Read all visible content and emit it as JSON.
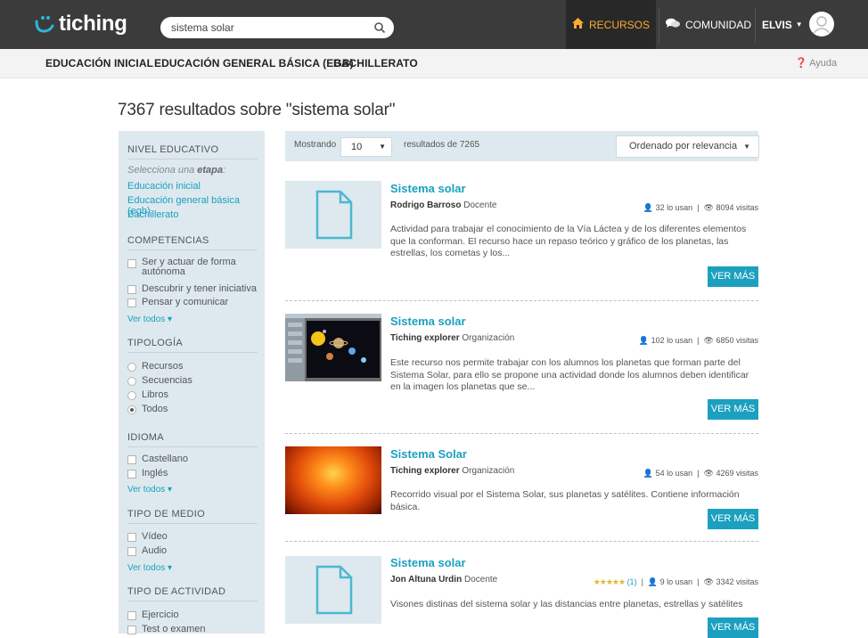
{
  "app": {
    "logo_text": "tiching"
  },
  "search": {
    "value": "sistema solar",
    "placeholder": "Buscar"
  },
  "topnav": {
    "recursos": "RECURSOS",
    "comunidad": "COMUNIDAD",
    "user": "ELVIS"
  },
  "levels": [
    "EDUCACIÓN INICIAL",
    "EDUCACIÓN GENERAL BÁSICA (EGB)",
    "BACHILLERATO"
  ],
  "help": "Ayuda",
  "results_title": "7367 resultados sobre \"sistema solar\"",
  "sidebar": {
    "nivel": {
      "heading": "NIVEL EDUCATIVO",
      "hint": "Selecciona una etapa:",
      "links": [
        "Educación inicial",
        "Educación general básica (egb)",
        "Bachillerato"
      ]
    },
    "competencias": {
      "heading": "COMPETENCIAS",
      "options": [
        "Ser y actuar de forma autónoma",
        "Descubrir y tener iniciativa",
        "Pensar y comunicar"
      ],
      "more": "Ver todos"
    },
    "tipologia": {
      "heading": "TIPOLOGÍA",
      "options": [
        "Recursos",
        "Secuencias",
        "Libros",
        "Todos"
      ],
      "selected": "Todos"
    },
    "idioma": {
      "heading": "IDIOMA",
      "options": [
        "Castellano",
        "Inglés"
      ],
      "more": "Ver todos"
    },
    "medio": {
      "heading": "TIPO DE MEDIO",
      "options": [
        "Vídeo",
        "Audio"
      ],
      "more": "Ver todos"
    },
    "actividad": {
      "heading": "TIPO DE ACTIVIDAD",
      "options": [
        "Ejercicio",
        "Test o examen"
      ]
    }
  },
  "controls": {
    "showing_label": "Mostrando",
    "per_page": "10",
    "of_label": "resultados de 7265",
    "order": "Ordenado por relevancia"
  },
  "results": [
    {
      "title": "Sistema solar",
      "author": "Rodrigo Barroso",
      "role": "Docente",
      "uses": "32 lo usan",
      "visits": "8094 visitas",
      "rating": "",
      "desc": "Actividad para trabajar el conocimiento de la Vía Láctea y de los diferentes elementos que la conforman. El recurso hace un repaso teórico y gráfico de los planetas, las estrellas, los cometas y los...",
      "button": "VER MÁS"
    },
    {
      "title": "Sistema solar",
      "author": "Tiching explorer",
      "role": "Organización",
      "uses": "102 lo usan",
      "visits": "6850 visitas",
      "rating": "",
      "desc": "Este recurso nos permite trabajar con los alumnos los planetas que forman parte del Sistema Solar, para ello se propone una actividad donde los alumnos deben identificar en la imagen los planetas que se...",
      "button": "VER MÁS"
    },
    {
      "title": "Sistema Solar",
      "author": "Tiching explorer",
      "role": "Organización",
      "uses": "54 lo usan",
      "visits": "4269 visitas",
      "rating": "",
      "desc": "Recorrido visual por el Sistema Solar, sus planetas y satélites. Contiene información básica.",
      "button": "VER MÁS"
    },
    {
      "title": "Sistema solar",
      "author": "Jon Altuna Urdin",
      "role": "Docente",
      "uses": "9 lo usan",
      "visits": "3342 visitas",
      "rating": "(1)",
      "stars": 5,
      "desc": "Visones distinas del sistema solar y las distancias entre planetas, estrellas y satélites",
      "button": "VER MÁS"
    }
  ],
  "colors": {
    "accent": "#1ca0bf",
    "topbar": "#3b3b3b",
    "nav_active": "#ffaa33",
    "sidebar_bg": "#dde9ee"
  }
}
